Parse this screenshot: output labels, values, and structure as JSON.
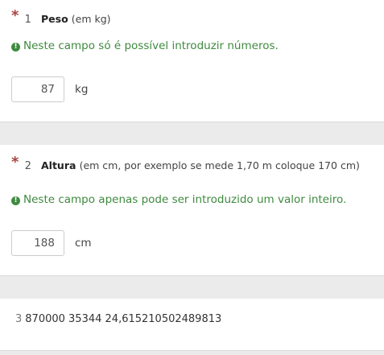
{
  "questions": [
    {
      "required_mark": "*",
      "number": "1",
      "title": "Peso",
      "help": "(em kg)",
      "tip": "Neste campo só é possível introduzir números.",
      "value": "87",
      "unit": "kg"
    },
    {
      "required_mark": "*",
      "number": "2",
      "title": "Altura",
      "help": "(em cm, por exemplo se mede 1,70 m coloque 170 cm)",
      "tip": "Neste campo apenas pode ser introduzido um valor inteiro.",
      "value": "188",
      "unit": "cm"
    }
  ],
  "equation": {
    "number": "3",
    "text": "870000 35344 24,615210502489813"
  },
  "colors": {
    "asterisk": "#a94442",
    "tip": "#3f8a3f",
    "gap": "#ebebeb"
  },
  "icons": {
    "tip_icon": "exclamation-circle-icon"
  }
}
